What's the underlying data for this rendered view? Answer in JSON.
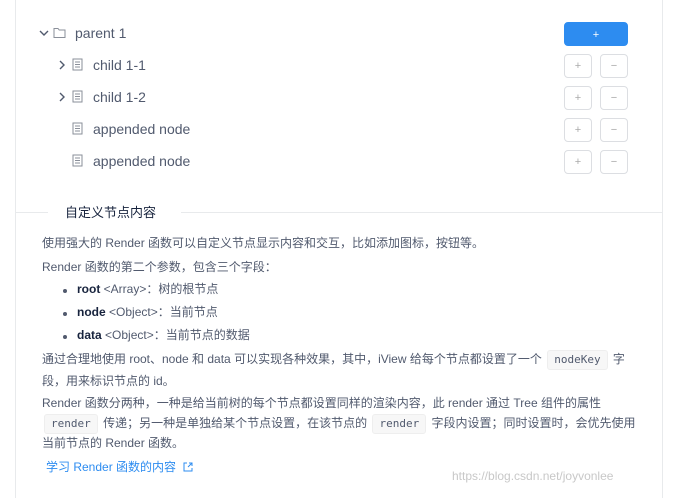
{
  "tree": {
    "parent": {
      "label": "parent 1",
      "add_label": "+"
    },
    "children": [
      {
        "label": "child 1-1",
        "add_label": "+",
        "remove_label": "−"
      },
      {
        "label": "child 1-2",
        "add_label": "+",
        "remove_label": "−"
      },
      {
        "label": "appended node",
        "add_label": "+",
        "remove_label": "−"
      },
      {
        "label": "appended node",
        "add_label": "+",
        "remove_label": "−"
      }
    ]
  },
  "section": {
    "title": "自定义节点内容",
    "p1": "使用强大的 Render 函数可以自定义节点显示内容和交互，比如添加图标，按钮等。",
    "p2": "Render 函数的第二个参数，包含三个字段：",
    "bullets": [
      {
        "key": "root",
        "type": "<Array>",
        "desc": "：树的根节点"
      },
      {
        "key": "node",
        "type": "<Object>",
        "desc": "：当前节点"
      },
      {
        "key": "data",
        "type": "<Object>",
        "desc": "：当前节点的数据"
      }
    ],
    "p3_a": "通过合理地使用 root、node 和 data 可以实现各种效果，其中，iView 给每个节点都设置了一个",
    "p3_code": "nodeKey",
    "p3_b": "字",
    "p3_c": "段，用来标识节点的 id。",
    "p4_a": "Render 函数分两种，一种是给当前树的每个节点都设置同样的渲染内容，此 render 通过 Tree 组件的属性",
    "p4_code1": "render",
    "p4_b": "传递；另一种是单独给某个节点设置，在该节点的",
    "p4_code2": "render",
    "p4_c": "字段内设置；同时设置时，会优先使用",
    "p4_d": "当前节点的 Render 函数。",
    "link": "学习 Render 函数的内容"
  },
  "watermark": "https://blog.csdn.net/joyvonlee",
  "colors": {
    "primary": "#2d8cf0",
    "text": "#515a6e",
    "heading": "#17233d",
    "border": "#dcdee2"
  }
}
